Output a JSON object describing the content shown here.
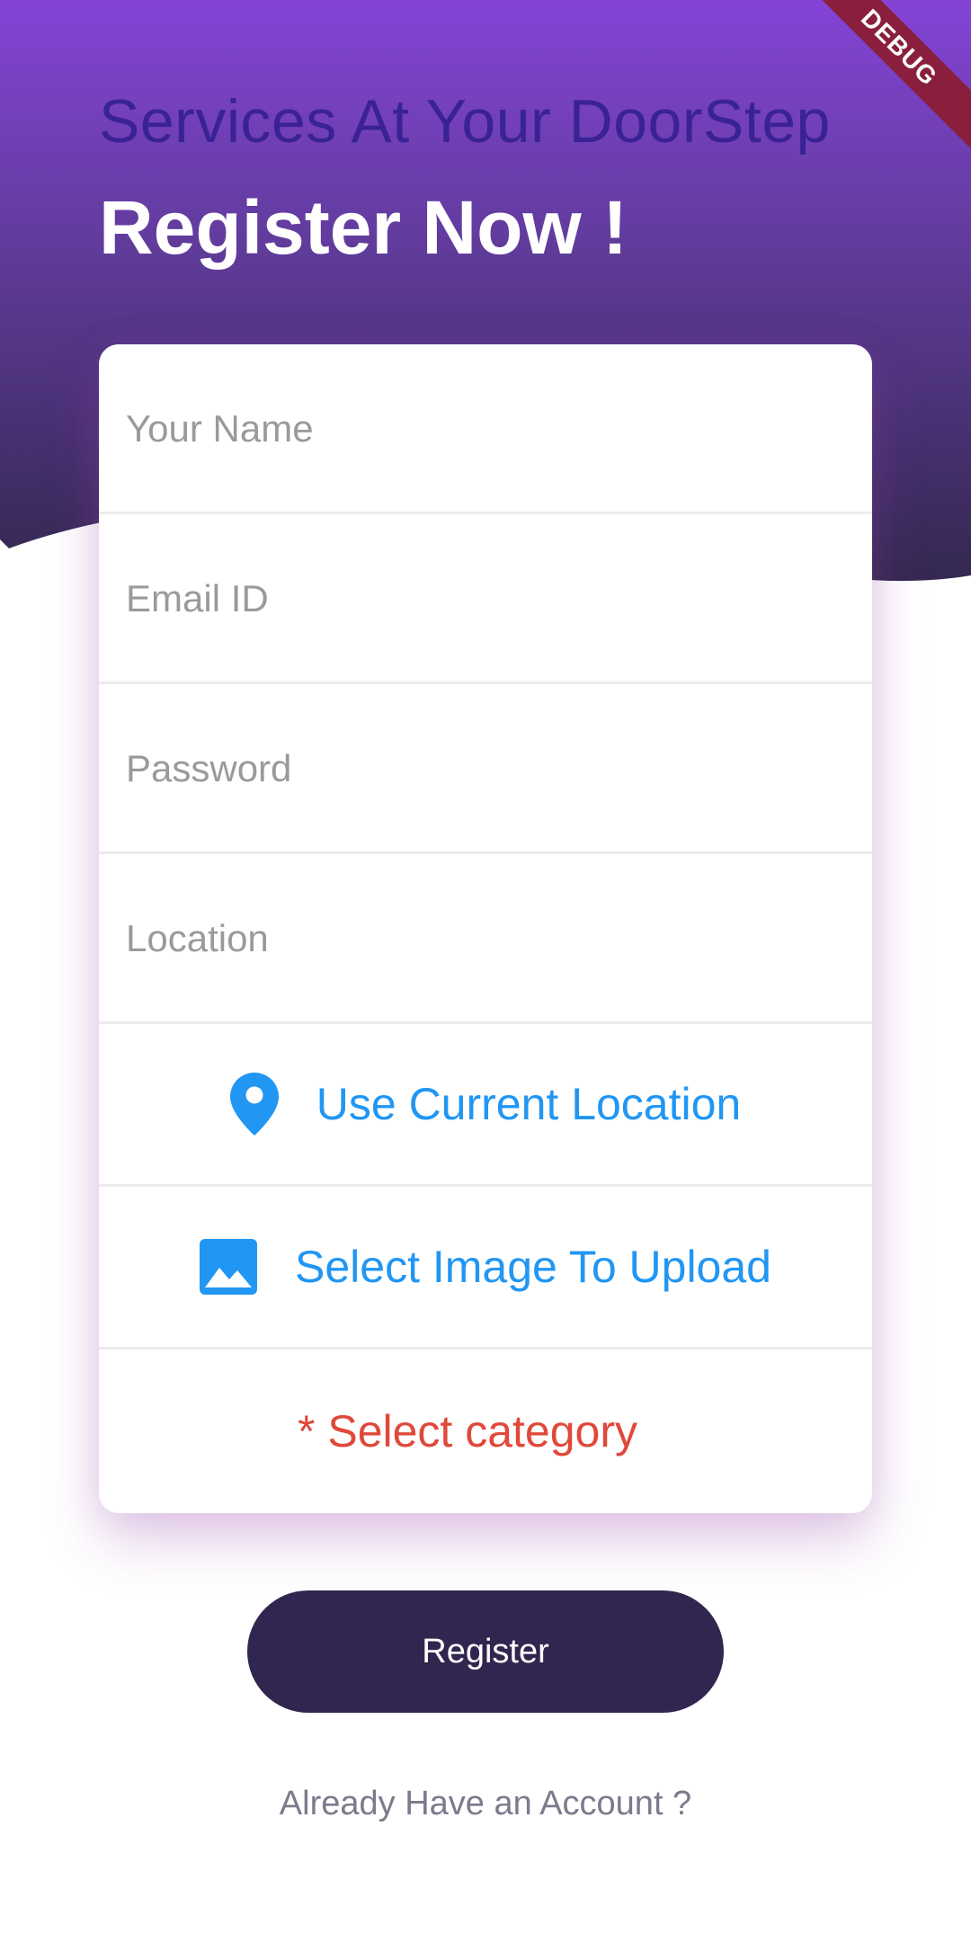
{
  "header": {
    "subtitle": "Services At Your DoorStep",
    "title": "Register Now !",
    "debug_badge": "DEBUG"
  },
  "form": {
    "name_placeholder": "Your Name",
    "email_placeholder": "Email ID",
    "password_placeholder": "Password",
    "location_placeholder": "Location",
    "use_location_label": "Use Current Location",
    "select_image_label": "Select Image To Upload",
    "select_category_label": "* Select category"
  },
  "actions": {
    "register_label": "Register",
    "login_link": "Already Have an Account ?"
  },
  "colors": {
    "header_top": "#8443d6",
    "header_bottom": "#362955",
    "accent_blue": "#2196f3",
    "error_red": "#e0483a",
    "button_dark": "#31264f"
  },
  "icons": {
    "location": "location-pin-icon",
    "image": "image-icon"
  }
}
